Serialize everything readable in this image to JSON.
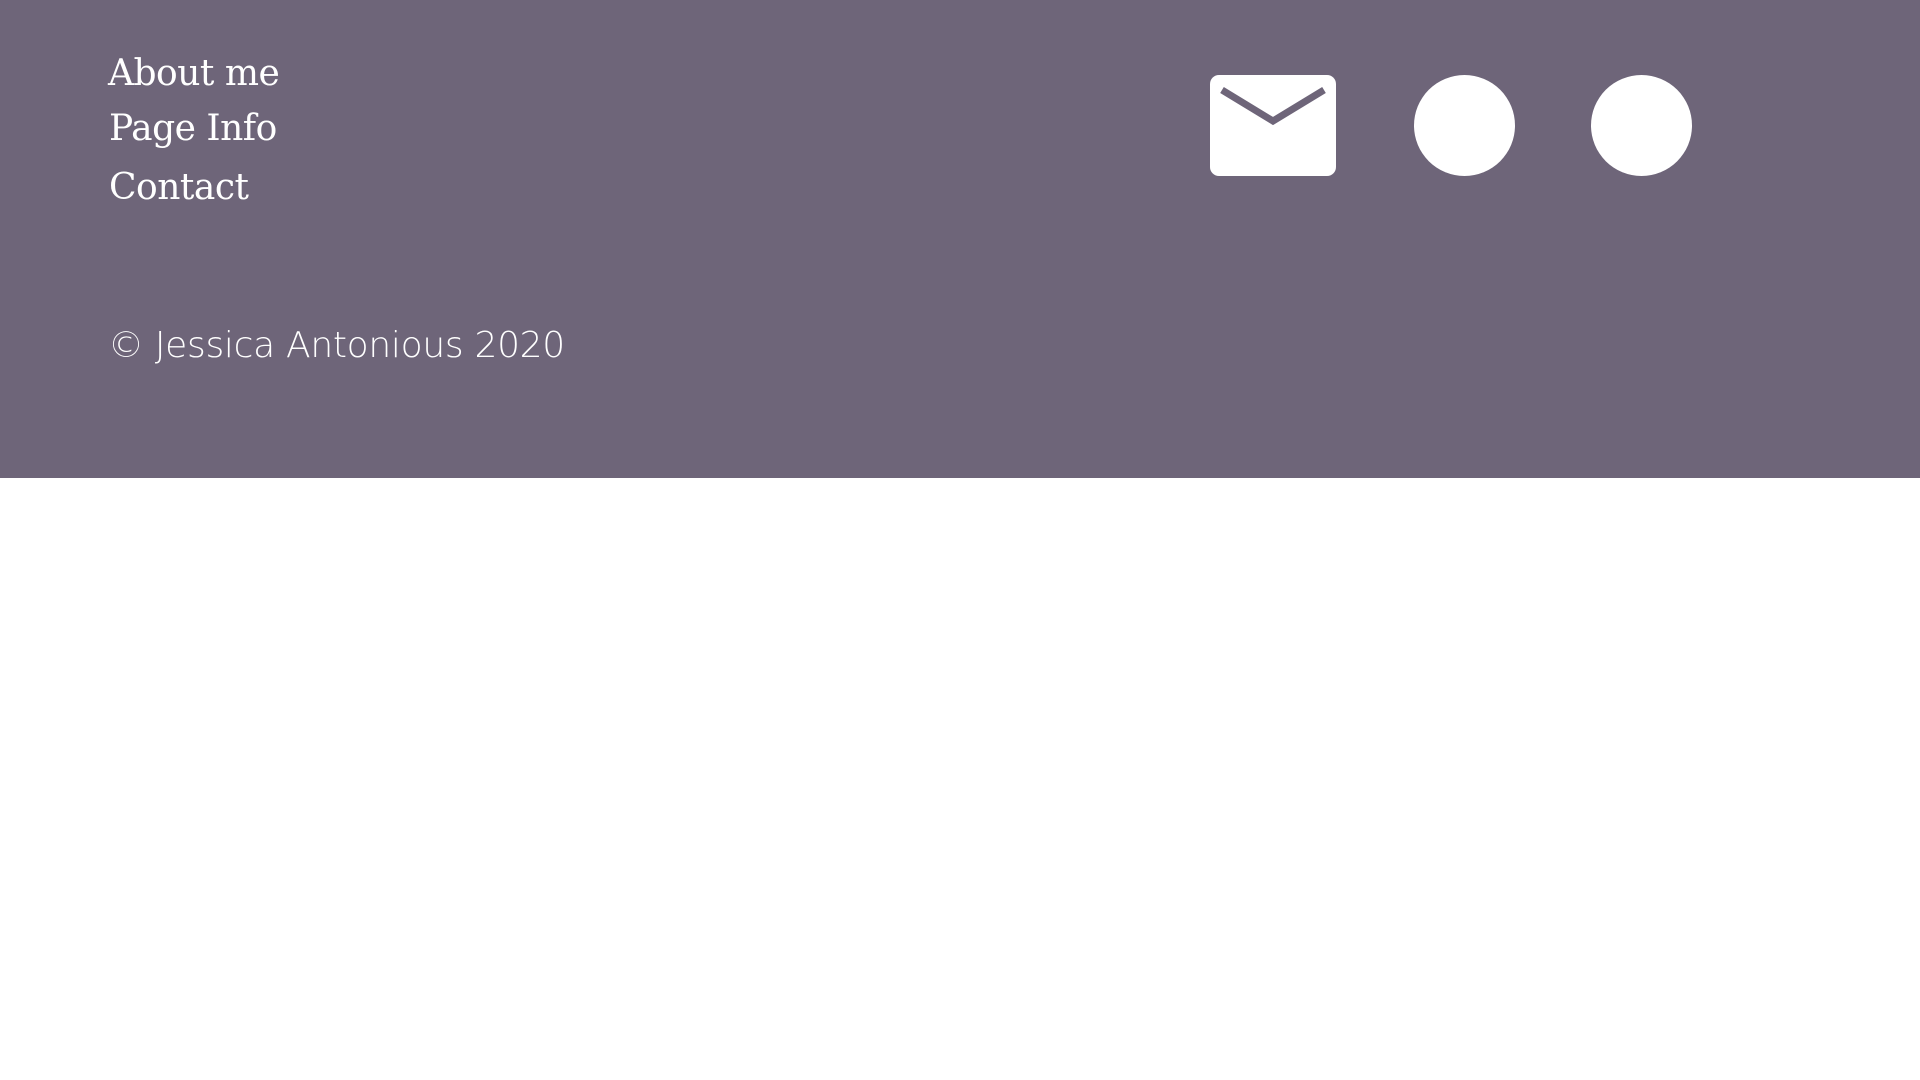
{
  "footer": {
    "background": "#6e6579",
    "text_color": "#ffffff",
    "nav": {
      "about": "About me",
      "page_info": "Page Info",
      "contact": "Contact"
    },
    "copyright": "© Jessica Antonious 2020",
    "icons": {
      "email": "mail-icon",
      "social_1": "social-circle-icon",
      "social_2": "social-circle-icon"
    }
  }
}
